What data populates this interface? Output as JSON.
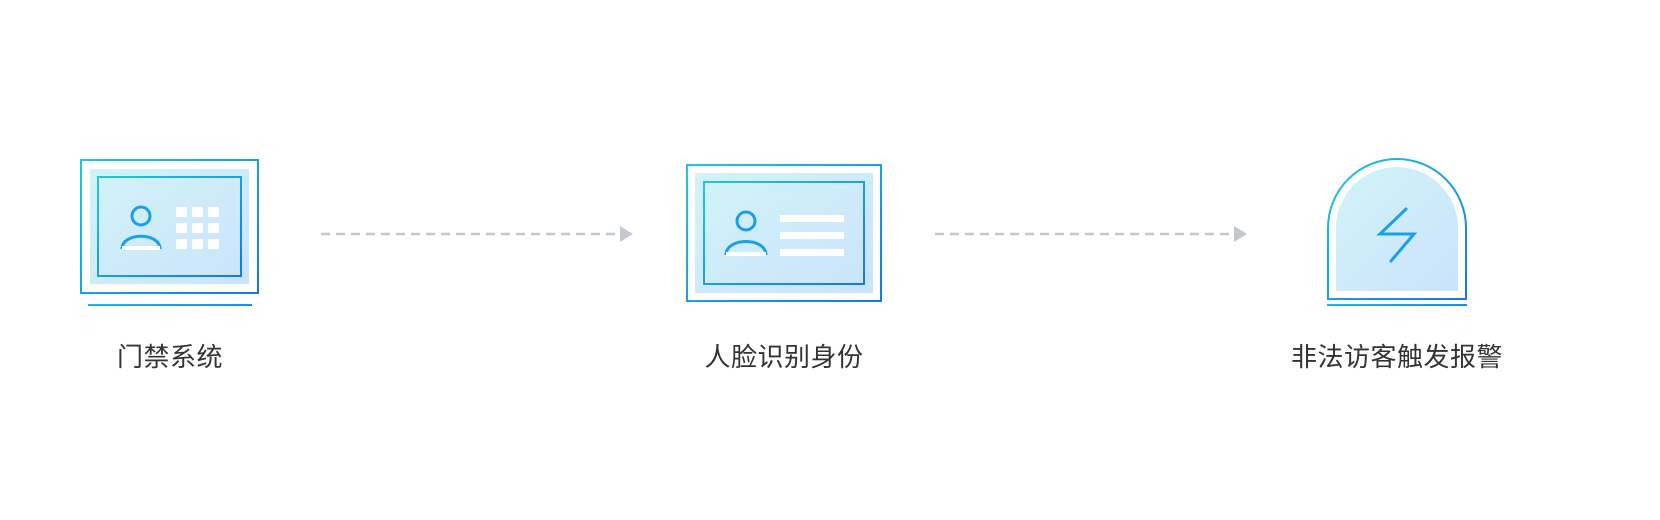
{
  "colors": {
    "frame_cyan": "#1ec8e0",
    "frame_blue": "#1677e8",
    "fill_light": "#cbeef7",
    "fill_light_blue": "#cfe6fb",
    "icon_blue": "#1aa0e8",
    "arrow_gray": "#c4c8cf",
    "label_text": "#333333"
  },
  "flow": {
    "steps": [
      {
        "label": "门禁系统",
        "icon": "access-control-keypad-icon"
      },
      {
        "label": "人脸识别身份",
        "icon": "id-card-icon"
      },
      {
        "label": "非法访客触发报警",
        "icon": "alarm-lightning-icon"
      }
    ],
    "connectors": [
      {
        "style": "dashed-arrow"
      },
      {
        "style": "dashed-arrow"
      }
    ]
  }
}
